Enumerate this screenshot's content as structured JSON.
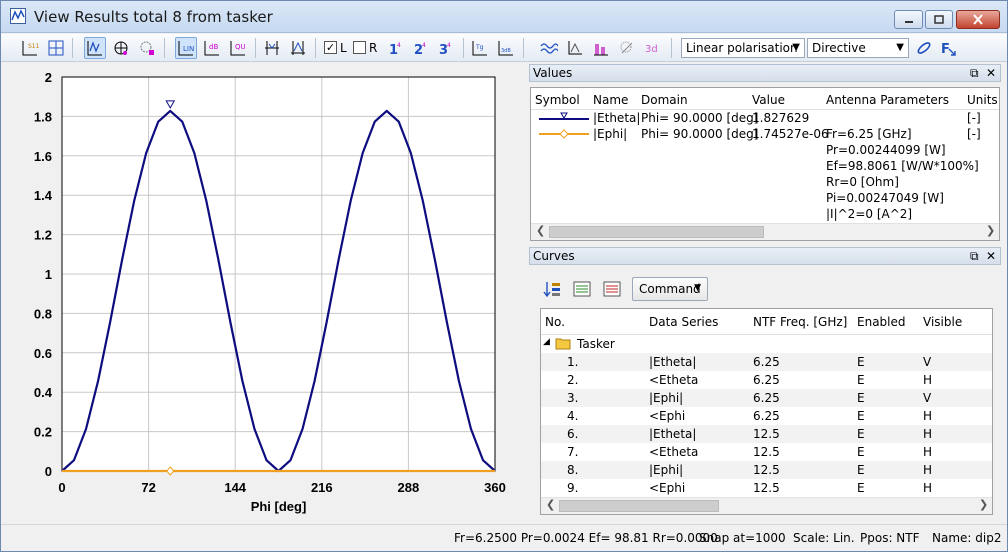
{
  "window": {
    "title": "View Results total 8 from tasker"
  },
  "toolbar": {
    "check_l_label": "L",
    "check_r_label": "R",
    "polarisation_value": "Linear polarisation",
    "mode_value": "Directive",
    "check_l_checked": true,
    "check_r_checked": false,
    "icons": [
      "s11-icon",
      "smith-icon",
      "vw-icon",
      "polar-icon",
      "3d-icon",
      "lin-icon",
      "db-icon",
      "qu-icon",
      "marker-icon",
      "marker-delta-icon",
      "num1-icon",
      "num2-icon",
      "num3-icon",
      "fit-icon",
      "scale-icon",
      "wave-icon",
      "chart-icon",
      "bar-icon",
      "grid-icon",
      "3d-grid-icon",
      "pen-icon",
      "fx-icon"
    ]
  },
  "chart_data": {
    "type": "line",
    "xlabel": "Phi [deg]",
    "ylabel": "",
    "xlim": [
      0,
      360
    ],
    "ylim": [
      0,
      2
    ],
    "xticks": [
      "0",
      "72",
      "144",
      "216",
      "288",
      "360"
    ],
    "yticks": [
      "0",
      "0.2",
      "0.4",
      "0.6",
      "0.8",
      "1",
      "1.2",
      "1.4",
      "1.6",
      "1.8",
      "2"
    ],
    "grid": true,
    "series": [
      {
        "color": "#0d0d80",
        "x": [
          0,
          10,
          20,
          30,
          40,
          50,
          60,
          70,
          80,
          90,
          100,
          110,
          120,
          130,
          140,
          150,
          160,
          170,
          180,
          190,
          200,
          210,
          220,
          230,
          240,
          250,
          260,
          270,
          280,
          290,
          300,
          310,
          320,
          330,
          340,
          350,
          360
        ],
        "values": [
          0,
          0.055,
          0.214,
          0.457,
          0.755,
          1.073,
          1.371,
          1.614,
          1.773,
          1.828,
          1.773,
          1.614,
          1.371,
          1.073,
          0.755,
          0.457,
          0.214,
          0.055,
          0,
          0.055,
          0.214,
          0.457,
          0.755,
          1.073,
          1.371,
          1.614,
          1.773,
          1.828,
          1.773,
          1.614,
          1.371,
          1.073,
          0.755,
          0.457,
          0.214,
          0.055,
          0
        ]
      },
      {
        "color": "#f0a020",
        "x": [
          0,
          360
        ],
        "values": [
          1.75e-06,
          1.75e-06
        ]
      }
    ],
    "markers": [
      {
        "series": 0,
        "x": 90,
        "y": 1.828,
        "shape": "triangle-down"
      },
      {
        "series": 1,
        "x": 90,
        "y": 1.75e-06,
        "shape": "diamond"
      }
    ]
  },
  "values_pane": {
    "title": "Values",
    "columns": [
      "Symbol",
      "Name",
      "Domain",
      "Value",
      "Antenna Parameters",
      "Units"
    ],
    "rows": [
      {
        "name": "|Etheta|",
        "domain": "Phi= 90.0000 [deg]",
        "value": "1.827629",
        "params": [
          "Fr=6.25 [GHz]",
          "Pr=0.00244099 [W]",
          "Ef=98.8061 [W/W*100%]",
          "Rr=0 [Ohm]",
          "Pi=0.00247049 [W]",
          "|I|^2=0 [A^2]"
        ],
        "units": [
          "[-]"
        ],
        "symbol_color": "#0d0d80",
        "symbol_marker": "triangle-down"
      },
      {
        "name": "|Ephi|",
        "domain": "Phi= 90.0000 [deg]",
        "value": "1.74527e-06",
        "params": [],
        "units": [
          "[-]"
        ],
        "symbol_color": "#f0a020",
        "symbol_marker": "diamond"
      }
    ]
  },
  "curves_pane": {
    "title": "Curves",
    "command_label": "Command",
    "columns": [
      "No.",
      "Data Series",
      "NTF Freq. [GHz]",
      "Enabled",
      "Visible"
    ],
    "group_label": "Tasker",
    "rows": [
      {
        "no": "1.",
        "series": "|Etheta|",
        "freq": "6.25",
        "enabled": "E",
        "visible": "V"
      },
      {
        "no": "2.",
        "series": "<Etheta",
        "freq": "6.25",
        "enabled": "E",
        "visible": "H"
      },
      {
        "no": "3.",
        "series": "|Ephi|",
        "freq": "6.25",
        "enabled": "E",
        "visible": "V"
      },
      {
        "no": "4.",
        "series": "<Ephi",
        "freq": "6.25",
        "enabled": "E",
        "visible": "H"
      },
      {
        "no": "6.",
        "series": "|Etheta|",
        "freq": "12.5",
        "enabled": "E",
        "visible": "H"
      },
      {
        "no": "7.",
        "series": "<Etheta",
        "freq": "12.5",
        "enabled": "E",
        "visible": "H"
      },
      {
        "no": "8.",
        "series": "|Ephi|",
        "freq": "12.5",
        "enabled": "E",
        "visible": "H"
      },
      {
        "no": "9.",
        "series": "<Ephi",
        "freq": "12.5",
        "enabled": "E",
        "visible": "H"
      }
    ]
  },
  "statusbar": {
    "readout": "Fr=6.2500 Pr=0.0024 Ef= 98.81 Rr=0.0000",
    "snap": "Snap at=1000",
    "scale": "Scale: Lin.",
    "ppos": "Ppos: NTF",
    "name": "Name: dip2"
  }
}
